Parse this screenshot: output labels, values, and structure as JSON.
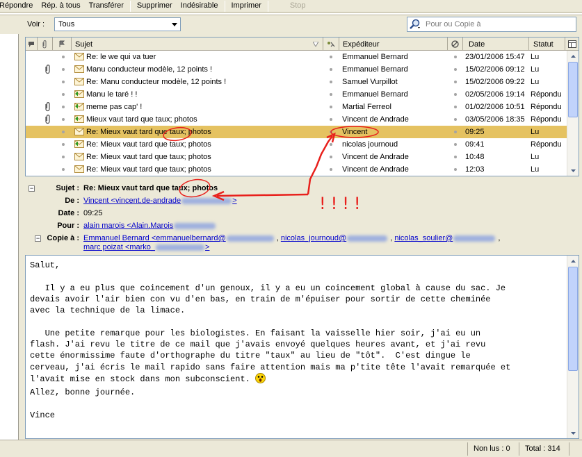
{
  "toolbar": {
    "buttons": [
      "Répondre",
      "Rép. à tous",
      "Transférer",
      "Supprimer",
      "Indésirable",
      "Imprimer",
      "Stop"
    ]
  },
  "filter": {
    "label": "Voir :",
    "value": "Tous"
  },
  "search": {
    "placeholder": "Pour ou Copie à"
  },
  "list": {
    "columns": {
      "subject": "Sujet",
      "sender": "Expéditeur",
      "date": "Date",
      "status": "Statut"
    },
    "rows": [
      {
        "subject": "Re: le we qui va tuer",
        "sender": "Emmanuel Bernard",
        "date": "23/01/2006 15:47",
        "status": "Lu",
        "attach": false,
        "replied": false
      },
      {
        "subject": "Manu conducteur modèle, 12 points !",
        "sender": "Emmanuel Bernard",
        "date": "15/02/2006 09:12",
        "status": "Lu",
        "attach": true,
        "replied": false
      },
      {
        "subject": "Re: Manu conducteur modèle, 12 points !",
        "sender": "Samuel Vurpillot",
        "date": "15/02/2006 09:22",
        "status": "Lu",
        "attach": false,
        "replied": false
      },
      {
        "subject": "Manu le taré ! !",
        "sender": "Emmanuel Bernard",
        "date": "02/05/2006 19:14",
        "status": "Répondu",
        "attach": false,
        "replied": true
      },
      {
        "subject": "meme pas cap' !",
        "sender": "Martial Ferreol",
        "date": "01/02/2006 10:51",
        "status": "Répondu",
        "attach": true,
        "replied": true
      },
      {
        "subject": "Mieux vaut tard que taux; photos",
        "sender": "Vincent de Andrade",
        "date": "03/05/2006 18:35",
        "status": "Répondu",
        "attach": true,
        "replied": true
      },
      {
        "subject": "Re: Mieux vaut tard que taux; photos",
        "sender": "Vincent",
        "date": "09:25",
        "status": "Lu",
        "attach": false,
        "replied": false,
        "selected": true
      },
      {
        "subject": "Re: Mieux vaut tard que taux; photos",
        "sender": "nicolas journoud",
        "date": "09:41",
        "status": "Répondu",
        "attach": false,
        "replied": true
      },
      {
        "subject": "Re: Mieux vaut tard que taux; photos",
        "sender": "Vincent de Andrade",
        "date": "10:48",
        "status": "Lu",
        "attach": false,
        "replied": false
      },
      {
        "subject": "Re: Mieux vaut tard que taux; photos",
        "sender": "Vincent de Andrade",
        "date": "12:03",
        "status": "Lu",
        "attach": false,
        "replied": false
      }
    ]
  },
  "header": {
    "subject_label": "Sujet :",
    "subject": "Re: Mieux vaut tard que taux; photos",
    "from_label": "De :",
    "from": "Vincent <vincent.de-andrade",
    "from_end": ">",
    "date_label": "Date :",
    "date": "09:25",
    "to_label": "Pour :",
    "to": "alain marois <Alain.Marois",
    "cc_label": "Copie à :",
    "cc1": "Emmanuel Bernard <emmanuelbernard@",
    "cc2": "nicolas_journoud@",
    "cc3": "nicolas_soulier@",
    "cc4": "marc poizat <marko_",
    "cc4_end": ">"
  },
  "body": {
    "text": "Salut,\n\n   Il y a eu plus que coincement d'un genoux, il y a eu un coincement global à cause du sac. Je\ndevais avoir l'air bien con vu d'en bas, en train de m'épuiser pour sortir de cette cheminée\navec la technique de la limace.\n\n   Une petite remarque pour les biologistes. En faisant la vaisselle hier soir, j'ai eu un\nflash. J'ai revu le titre de ce mail que j'avais envoyé quelques heures avant, et j'ai revu\ncette énormissime faute d'orthographe du titre \"taux\" au lieu de \"tôt\".  C'est dingue le\ncerveau, j'ai écris le mail rapido sans faire attention mais ma p'tite tête l'avait remarquée et\nl'avait mise en stock dans mon subconscient.",
    "closing": "Allez, bonne journée.\n\nVince"
  },
  "annotation": {
    "text": "!!!!"
  },
  "status": {
    "unread": "Non lus : 0",
    "total": "Total : 314"
  },
  "colors": {
    "selected_row": "#e5c261",
    "link": "#0000cc",
    "annotation": "#e8201c"
  }
}
